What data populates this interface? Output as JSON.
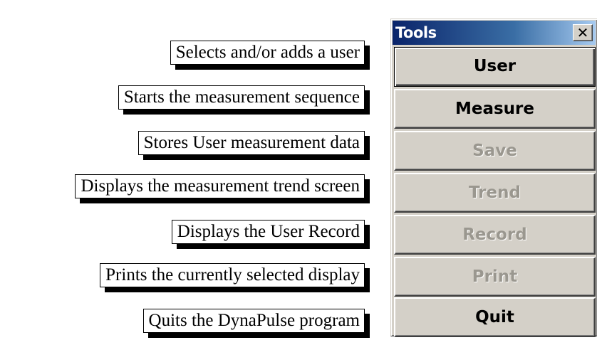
{
  "callouts": [
    {
      "id": "user",
      "text": "Selects and/or adds a user"
    },
    {
      "id": "measure",
      "text": "Starts the measurement sequence"
    },
    {
      "id": "save",
      "text": "Stores User measurement data"
    },
    {
      "id": "trend",
      "text": "Displays the measurement trend screen"
    },
    {
      "id": "record",
      "text": "Displays the User Record"
    },
    {
      "id": "print",
      "text": "Prints the currently selected display"
    },
    {
      "id": "quit",
      "text": "Quits the DynaPulse program"
    }
  ],
  "window": {
    "title": "Tools",
    "close_label": "✕"
  },
  "buttons": [
    {
      "id": "user",
      "label": "User",
      "enabled": true,
      "default": true
    },
    {
      "id": "measure",
      "label": "Measure",
      "enabled": true,
      "default": false
    },
    {
      "id": "save",
      "label": "Save",
      "enabled": false,
      "default": false
    },
    {
      "id": "trend",
      "label": "Trend",
      "enabled": false,
      "default": false
    },
    {
      "id": "record",
      "label": "Record",
      "enabled": false,
      "default": false
    },
    {
      "id": "print",
      "label": "Print",
      "enabled": false,
      "default": false
    },
    {
      "id": "quit",
      "label": "Quit",
      "enabled": true,
      "default": false
    }
  ]
}
